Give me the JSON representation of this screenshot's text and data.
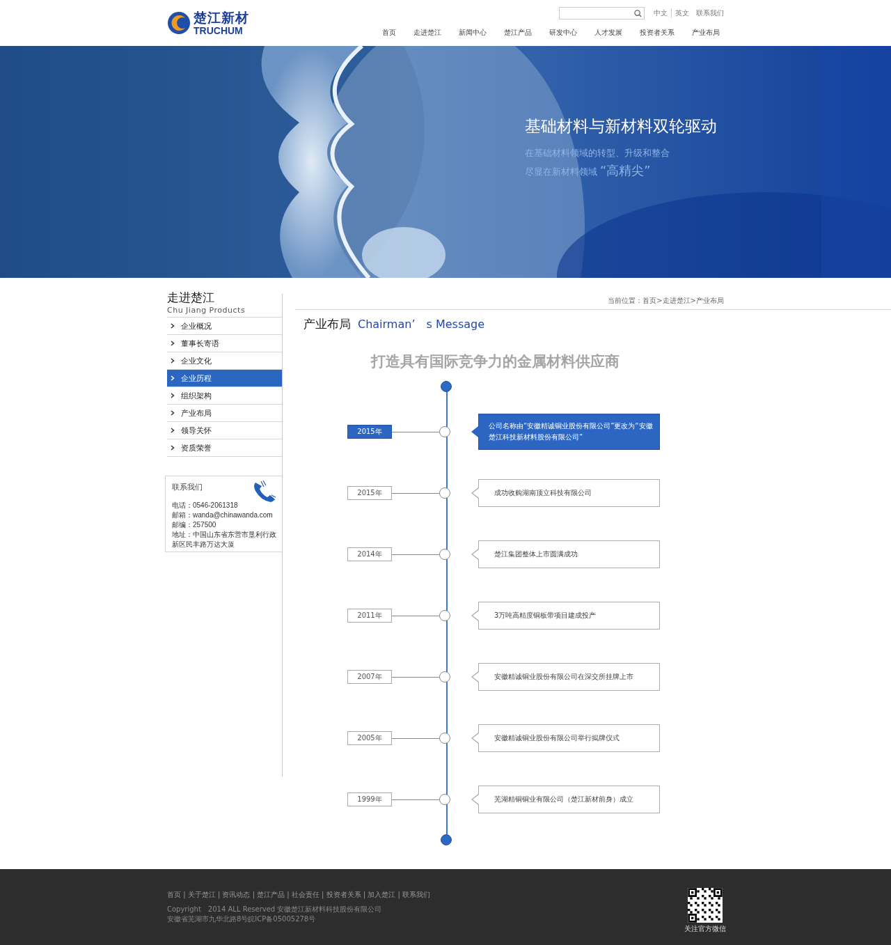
{
  "header": {
    "logo_cn": "楚江新材",
    "logo_en": "TRUCHUM",
    "top_links": [
      "中文",
      "英文",
      "联系我们"
    ],
    "nav": [
      "首页",
      "走进楚江",
      "新闻中心",
      "楚江产品",
      "研发中心",
      "人才发展",
      "投资者关系",
      "产业布局"
    ]
  },
  "banner": {
    "kind": "picture",
    "title": "基础材料与新材料双轮驱动",
    "line_1": "在基础材料领域的转型、升级和整合",
    "line_2_prefix": "尽显在新材料领域",
    "line_2_quote": "“高精尖”"
  },
  "sidebar": {
    "title": "走进楚江",
    "subtitle": "Chu Jiang Products",
    "items": [
      {
        "label": "企业概况",
        "selected": false
      },
      {
        "label": "董事长寄语",
        "selected": false
      },
      {
        "label": "企业文化",
        "selected": false
      },
      {
        "label": "企业历程",
        "selected": true
      },
      {
        "label": "组织架构",
        "selected": false
      },
      {
        "label": "产业布局",
        "selected": false
      },
      {
        "label": "领导关怀",
        "selected": false
      },
      {
        "label": "资质荣誉",
        "selected": false
      }
    ],
    "contact": {
      "title": "联系我们",
      "lines": [
        "电话：0546-2061318",
        "邮箱：wanda@chinawanda.com",
        "邮编：257500",
        "地址：中国山东省东营市垦利行政新区民丰路万达大厦"
      ]
    }
  },
  "breadcrumb": "当前位置：首页>走进楚江>产业布局",
  "page_title": {
    "cn": "产业布局",
    "en": "Chairman’　s Message"
  },
  "headline": "打造具有国际竞争力的金属材料供应商",
  "timeline": [
    {
      "year": "2015年",
      "text": "公司名称由“安徽精诚铜业股份有限公司”更改为“安徽楚江科技新材料股份有限公司”",
      "selected": true
    },
    {
      "year": "2015年",
      "text": "成功收购湖南顶立科技有限公司",
      "selected": false
    },
    {
      "year": "2014年",
      "text": "楚江集团整体上市圆满成功",
      "selected": false
    },
    {
      "year": "2011年",
      "text": "3万吨高精度铜板带项目建成投产",
      "selected": false
    },
    {
      "year": "2007年",
      "text": "安徽精诚铜业股份有限公司在深交所挂牌上市",
      "selected": false
    },
    {
      "year": "2005年",
      "text": "安徽精诚铜业股份有限公司举行揭牌仪式",
      "selected": false
    },
    {
      "year": "1999年",
      "text": "芜湖精铜铜业有限公司（楚江新材前身）成立",
      "selected": false
    }
  ],
  "footer": {
    "links": "首页 | 关于楚江 | 资讯动态 | 楚江产品 | 社会责任 | 投资者关系 | 加入楚江 | 联系我们",
    "copyright": "Copyright　2014 ALL Reserved 安徽楚江新材料科技股份有限公司",
    "icp": "安徽省芜湖市九华北路8号皖ICP备05005278号",
    "qr_caption": "关注官方微信"
  }
}
